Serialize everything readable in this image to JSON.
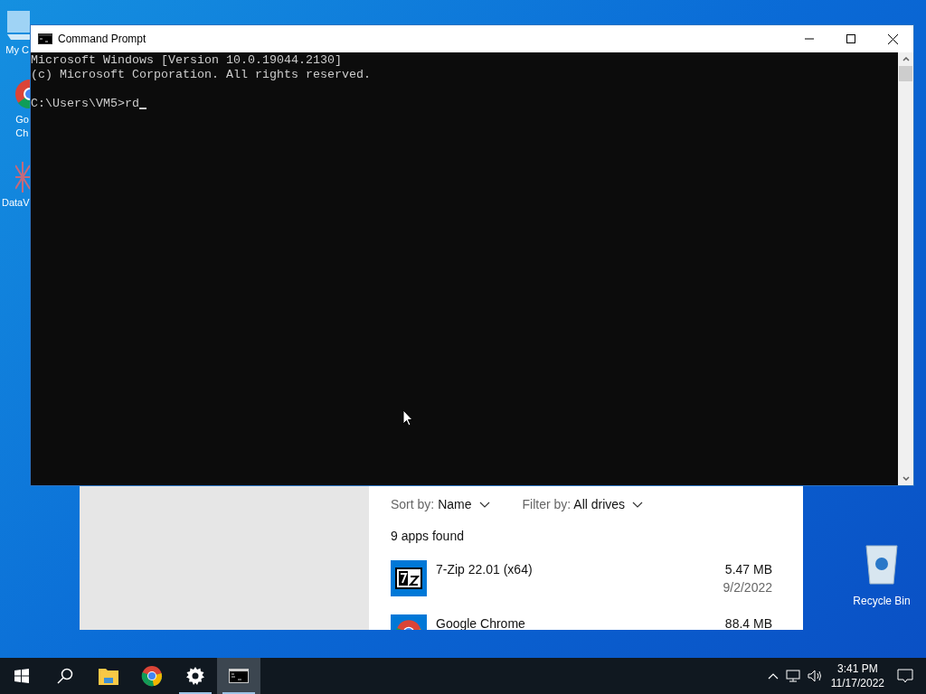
{
  "desktop_icons": [
    {
      "kind": "computer",
      "lines": [
        "My C"
      ]
    },
    {
      "kind": "chrome",
      "lines": [
        "Go",
        "Ch"
      ]
    },
    {
      "kind": "dataviz",
      "lines": [
        "DataV"
      ]
    }
  ],
  "recycle_bin": {
    "label": "Recycle Bin"
  },
  "settings_window": {
    "sort_label": "Sort by:",
    "sort_value": "Name",
    "filter_label": "Filter by:",
    "filter_value": "All drives",
    "count": "9 apps found",
    "apps": [
      {
        "kind": "sevenzip",
        "name": "7-Zip 22.01 (x64)",
        "size": "5.47 MB",
        "date": "9/2/2022"
      },
      {
        "kind": "chrome",
        "name": "Google Chrome",
        "size": "88.4 MB"
      }
    ]
  },
  "cmd_window": {
    "title": "Command Prompt",
    "header": [
      "Microsoft Windows [Version 10.0.19044.2130]",
      "(c) Microsoft Corporation. All rights reserved."
    ],
    "prompt": "C:\\Users\\VM5>rd"
  },
  "taskbar": {
    "items": [
      {
        "kind": "start",
        "running": false,
        "selected": false
      },
      {
        "kind": "search",
        "running": false,
        "selected": false
      },
      {
        "kind": "explorer",
        "running": false,
        "selected": false
      },
      {
        "kind": "chrome",
        "running": false,
        "selected": false
      },
      {
        "kind": "settings",
        "running": true,
        "selected": false
      },
      {
        "kind": "cmd",
        "running": true,
        "selected": true
      }
    ],
    "time": "3:41 PM",
    "date": "11/17/2022"
  }
}
